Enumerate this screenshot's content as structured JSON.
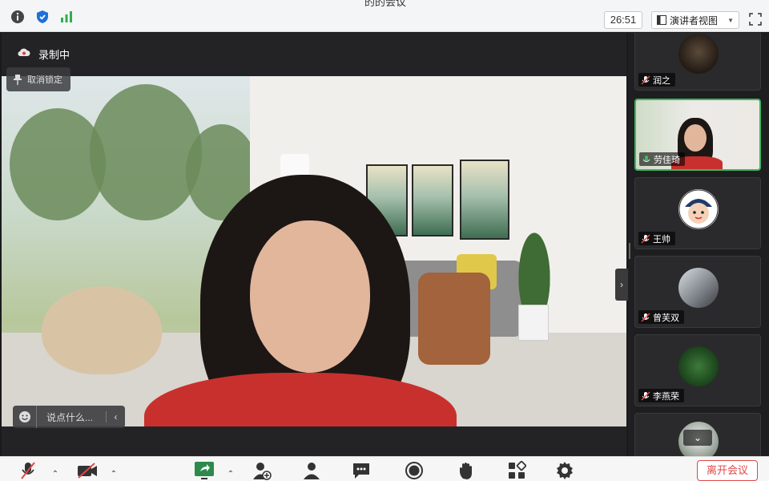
{
  "window": {
    "title": "的的会议"
  },
  "header": {
    "timer": "26:51",
    "view_label": "演讲者视图"
  },
  "stage": {
    "recording_label": "录制中",
    "unpin_label": "取消锁定",
    "chat_placeholder": "说点什么..."
  },
  "participants": [
    {
      "name": "润之",
      "muted": true
    },
    {
      "name": "劳佳琦",
      "muted": false,
      "active": true
    },
    {
      "name": "王帅",
      "muted": true
    },
    {
      "name": "曾芙双",
      "muted": true
    },
    {
      "name": "李燕荣",
      "muted": true
    },
    {
      "name": "",
      "muted": true
    }
  ],
  "toolbar": {
    "leave_label": "离开会议"
  },
  "colors": {
    "active_border": "#3bb860",
    "leave_red": "#e04848",
    "shield_blue": "#1e6fd9",
    "signal_green": "#2fae4f"
  }
}
